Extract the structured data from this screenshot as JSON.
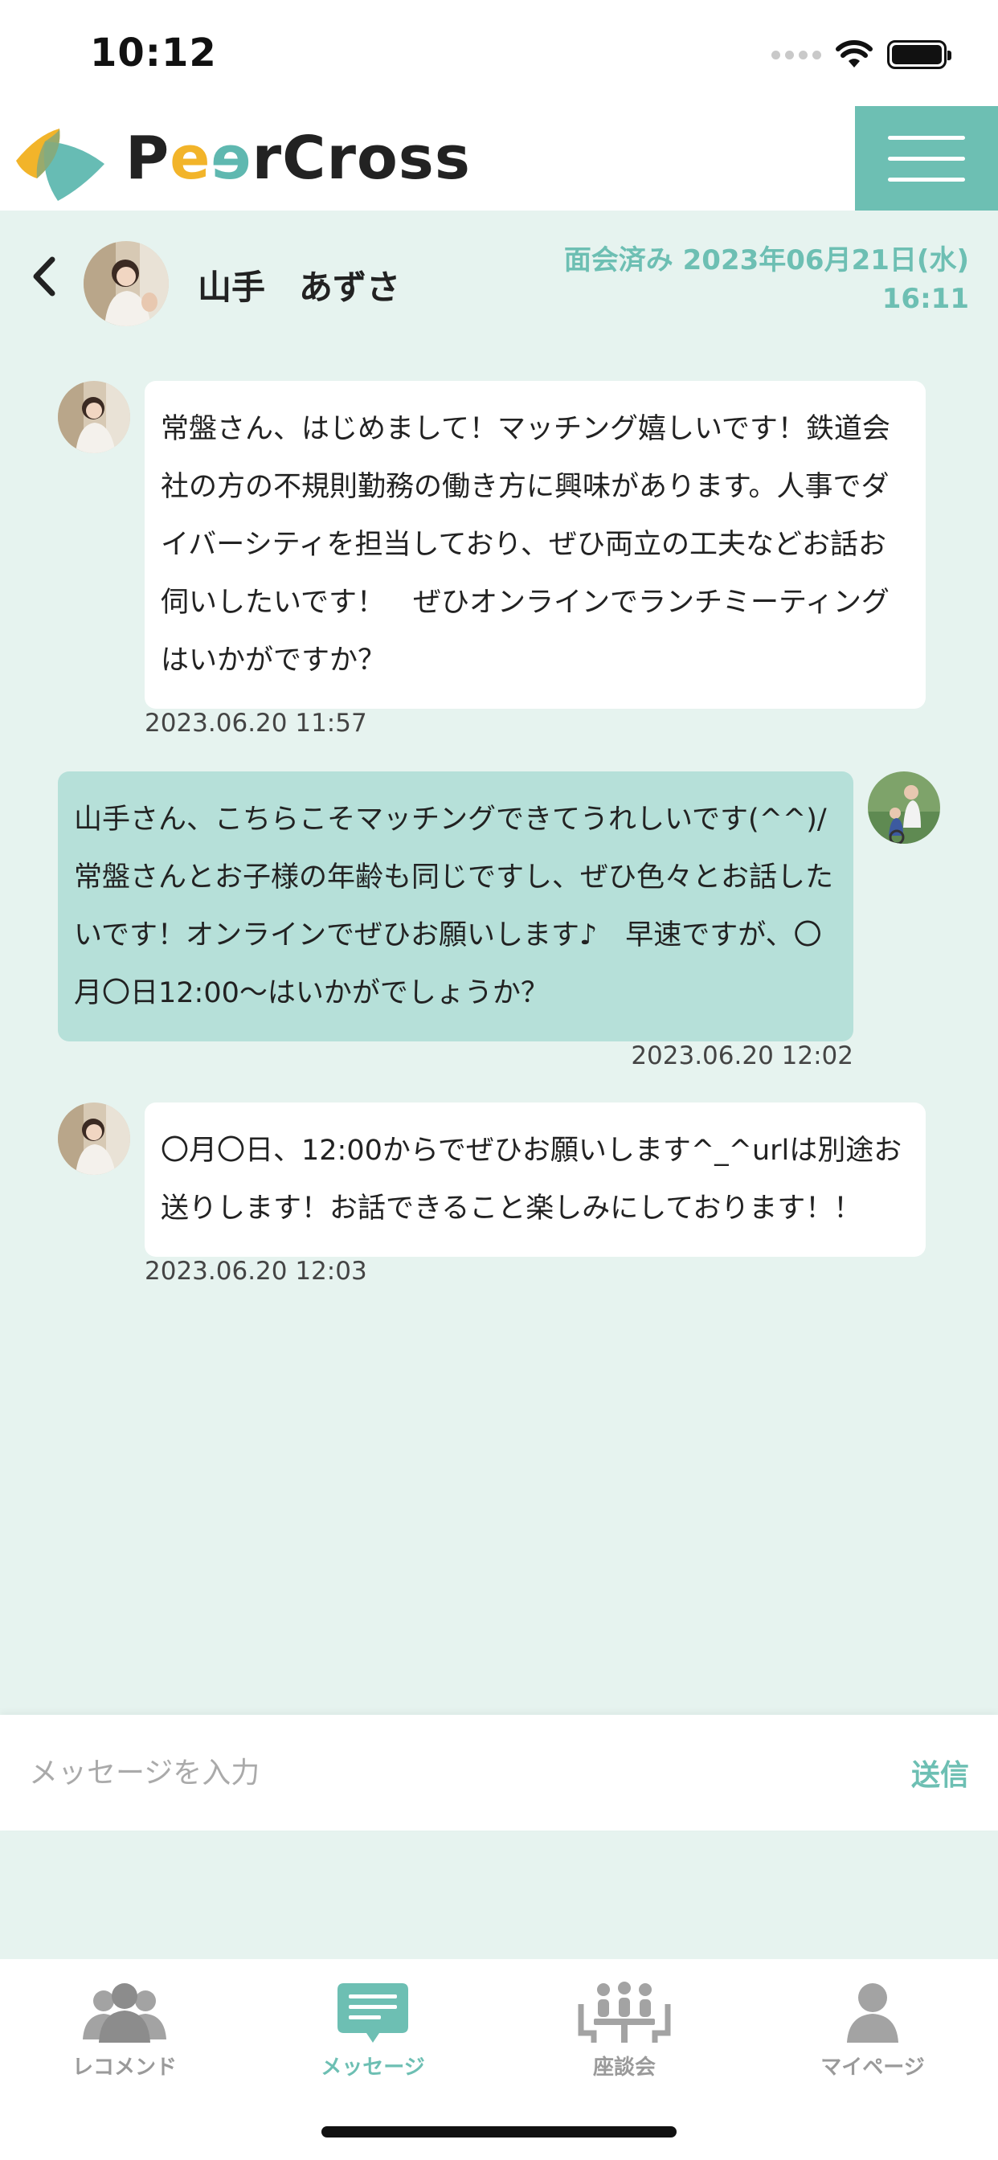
{
  "status_bar": {
    "time": "10:12"
  },
  "header": {
    "logo_text": "PeerCross"
  },
  "chat": {
    "partner_name": "山手　あずさ",
    "met_status_line1": "面会済み 2023年06月21日(水)",
    "met_status_line2": "16:11"
  },
  "messages": [
    {
      "direction": "received",
      "text": "常盤さん、はじめまして！マッチング嬉しいです！鉄道会社の方の不規則勤務の働き方に興味があります。人事でダイバーシティを担当しており、ぜひ両立の工夫などお話お伺いしたいです！　ぜひオンラインでランチミーティングはいかがですか？",
      "timestamp": "2023.06.20 11:57"
    },
    {
      "direction": "sent",
      "text": "山手さん、こちらこそマッチングできてうれしいです(^^)/常盤さんとお子様の年齢も同じですし、ぜひ色々とお話したいです！オンラインでぜひお願いします♪　早速ですが、〇月〇日12:00〜はいかがでしょうか？",
      "timestamp": "2023.06.20 12:02"
    },
    {
      "direction": "received",
      "text": "〇月〇日、12:00からでぜひお願いします^_^urlは別途お送りします！お話できること楽しみにしております！！",
      "timestamp": "2023.06.20 12:03"
    }
  ],
  "input": {
    "placeholder": "メッセージを入力",
    "value": "",
    "send_label": "送信"
  },
  "nav": {
    "items": [
      {
        "label": "レコメンド",
        "icon": "people-icon",
        "active": false
      },
      {
        "label": "メッセージ",
        "icon": "message-icon",
        "active": true
      },
      {
        "label": "座談会",
        "icon": "roundtable-icon",
        "active": false
      },
      {
        "label": "マイページ",
        "icon": "user-icon",
        "active": false
      }
    ]
  },
  "colors": {
    "accent": "#6dbfb3",
    "background": "#e6f3ef",
    "sent_bubble": "#b6e0d9",
    "received_bubble": "#ffffff",
    "nav_inactive": "#9a9a9a"
  }
}
